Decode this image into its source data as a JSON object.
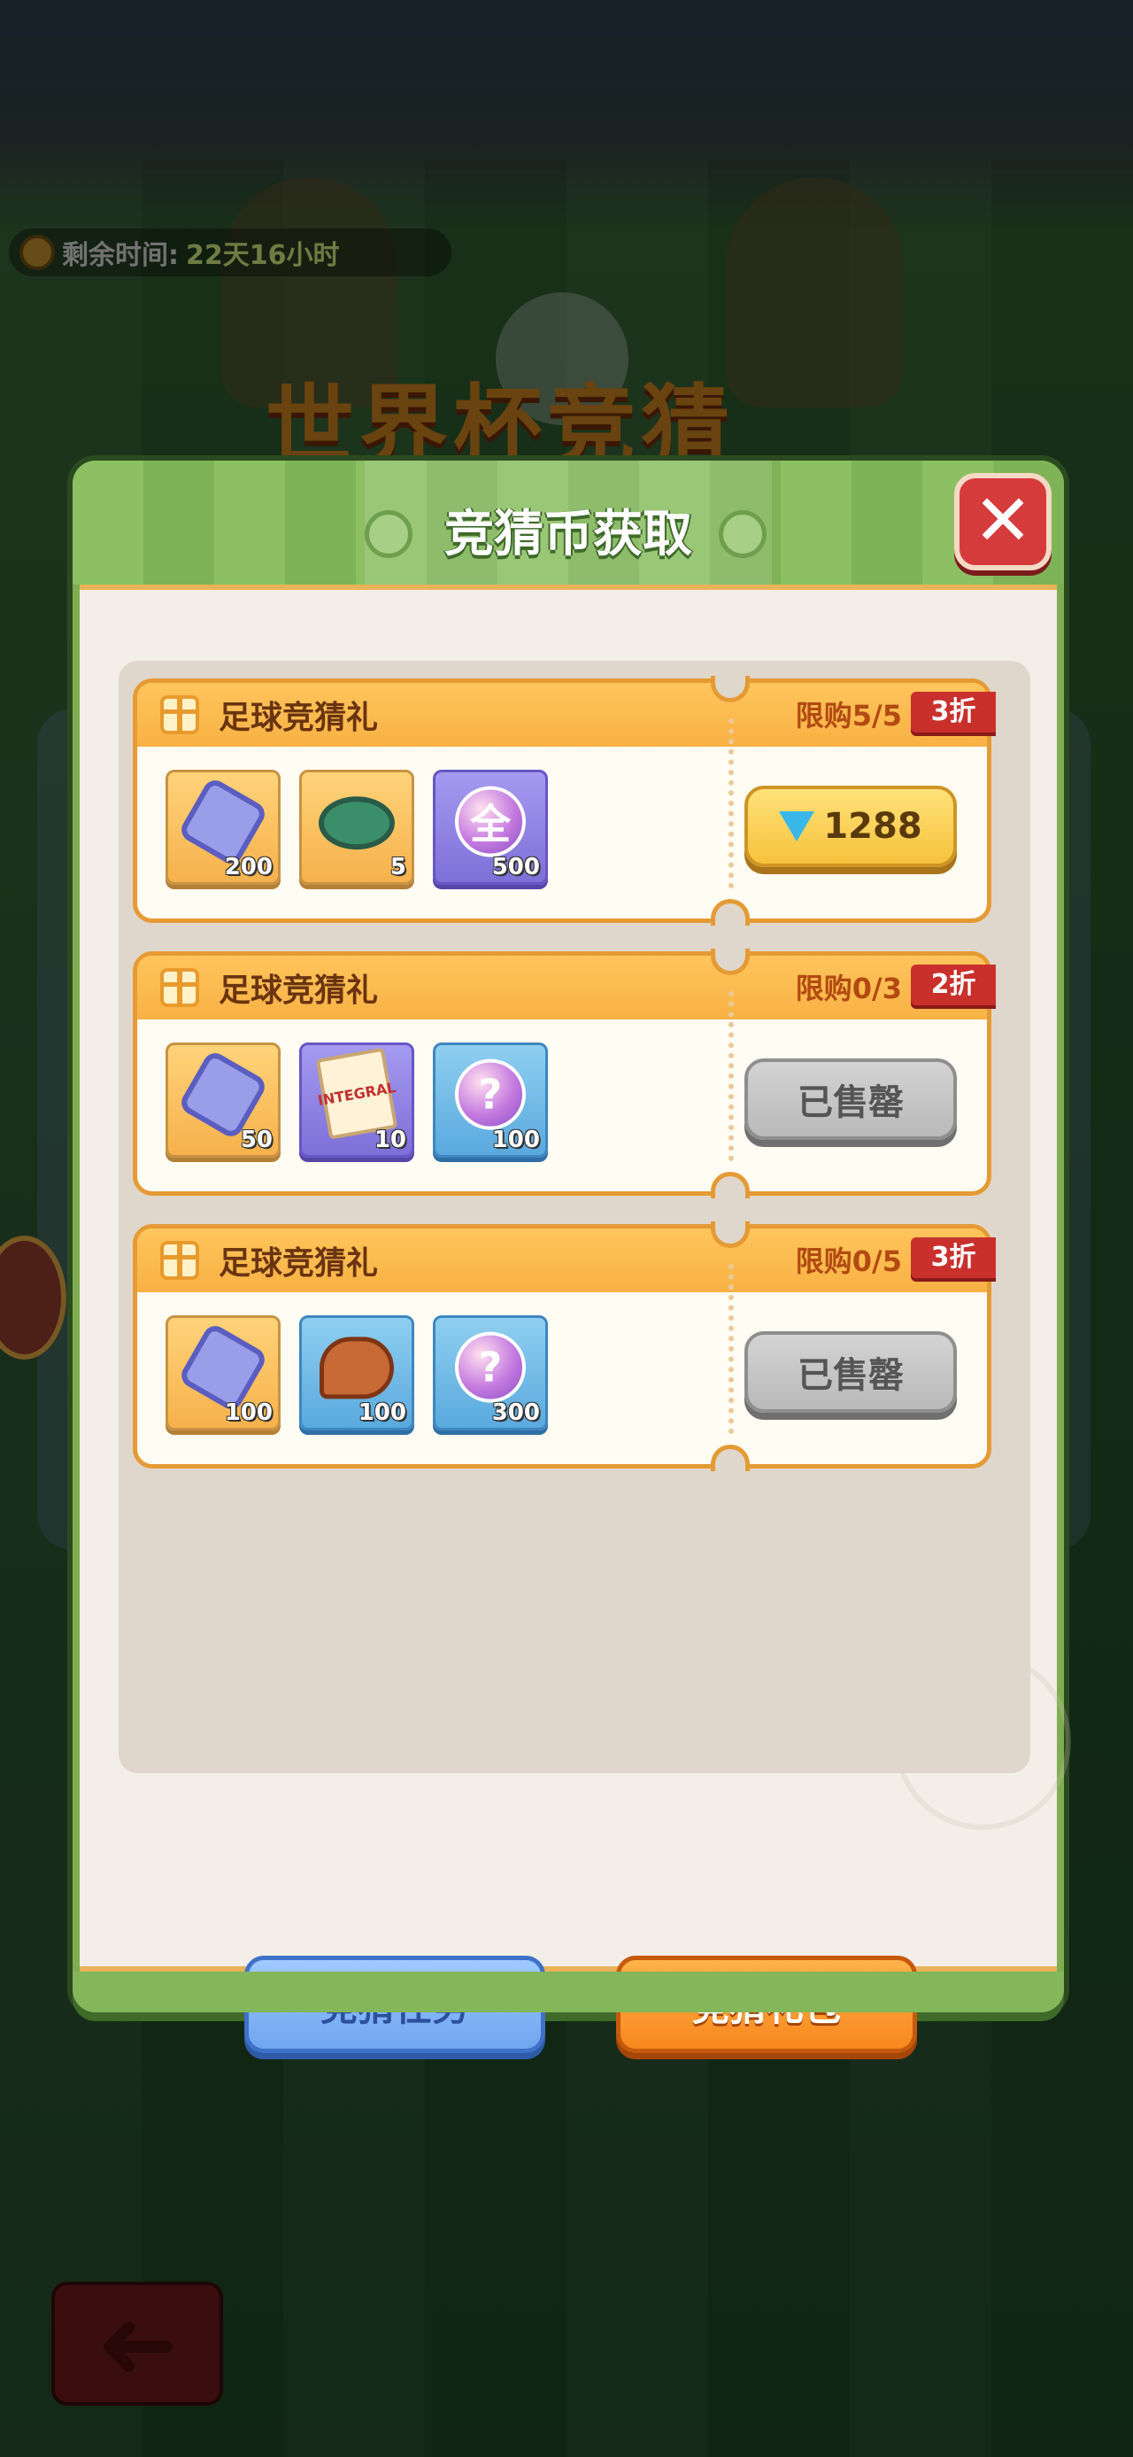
{
  "hud": {
    "timer_label": "剩余时间:",
    "timer_value": "22天16小时",
    "banner_text": "世界杯竞猜"
  },
  "modal": {
    "title": "竞猜币获取",
    "close_label": "✕"
  },
  "gifts": [
    {
      "title": "足球竞猜礼",
      "limit": "限购5/5",
      "discount": "3折",
      "items": [
        {
          "icon": "hexagon-coin-icon",
          "style": "gold",
          "count": "200"
        },
        {
          "icon": "spinning-top-icon",
          "style": "gold",
          "count": "5"
        },
        {
          "icon": "all-orb-icon",
          "style": "purple",
          "glyph": "全",
          "count": "500"
        }
      ],
      "action": {
        "type": "price",
        "label": "1288",
        "icon": "diamond-icon"
      }
    },
    {
      "title": "足球竞猜礼",
      "limit": "限购0/3",
      "discount": "2折",
      "items": [
        {
          "icon": "hexagon-coin-icon",
          "style": "gold",
          "count": "50"
        },
        {
          "icon": "integral-paper-icon",
          "style": "purple",
          "glyph": "INTEGRAL",
          "count": "10"
        },
        {
          "icon": "mystery-orb-icon",
          "style": "blue",
          "glyph": "?",
          "count": "100"
        }
      ],
      "action": {
        "type": "sold",
        "label": "已售罄"
      }
    },
    {
      "title": "足球竞猜礼",
      "limit": "限购0/5",
      "discount": "3折",
      "items": [
        {
          "icon": "hexagon-coin-icon",
          "style": "gold",
          "count": "100"
        },
        {
          "icon": "meat-icon",
          "style": "blue",
          "glyph": "",
          "count": "100"
        },
        {
          "icon": "mystery-orb-icon",
          "style": "blue",
          "glyph": "?",
          "count": "300"
        }
      ],
      "action": {
        "type": "sold",
        "label": "已售罄"
      }
    }
  ],
  "tabs": {
    "task_label": "竞猜任务",
    "gift_label": "竞猜礼包",
    "active": "gift"
  },
  "colors": {
    "header_green": "#8cc063",
    "card_orange": "#e59a34",
    "discount_red": "#c9302c",
    "price_gold": "#f6c23c",
    "sold_gray": "#b9b9b9",
    "tab_blue": "#6fa6ee",
    "tab_orange": "#f7881f"
  },
  "back_button": {
    "icon": "back-arrow-icon",
    "label": "➜"
  }
}
